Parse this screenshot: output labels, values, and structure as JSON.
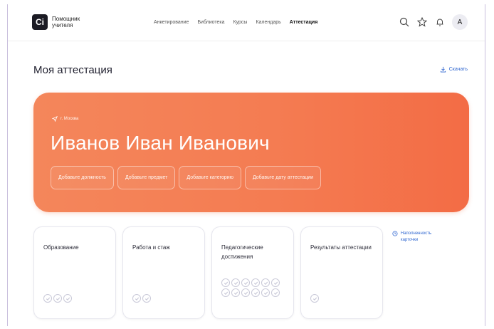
{
  "app": {
    "logo_mark": "Ci",
    "logo_text": "Помощник учителя"
  },
  "nav": {
    "items": [
      "Анкетирование",
      "Библиотека",
      "Курсы",
      "Календарь",
      "Аттестация"
    ],
    "active": "Аттестация"
  },
  "header_tools": {
    "icons": [
      "search-icon",
      "star-icon",
      "bell-icon"
    ],
    "avatar_letter": "А"
  },
  "page": {
    "title": "Моя аттестация",
    "download_label": "Скачать"
  },
  "hero": {
    "city": "г. Москва",
    "name": "Иванов Иван Иванович",
    "chips": [
      "Добавьте должность",
      "Добавьте предмет",
      "Добавьте категорию",
      "Добавьте дату аттестации"
    ],
    "colors": {
      "start": "#f4865b",
      "end": "#f36c45"
    }
  },
  "cards": [
    {
      "title": "Образование",
      "check_count": 3
    },
    {
      "title": "Работа и стаж",
      "check_count": 2
    },
    {
      "title": "Педагогические достижения",
      "check_count": 12
    },
    {
      "title": "Результаты аттестации",
      "check_count": 1
    }
  ],
  "fill_info": {
    "label": "Наполненность карточки"
  },
  "colors": {
    "accent": "#2f66d0"
  }
}
